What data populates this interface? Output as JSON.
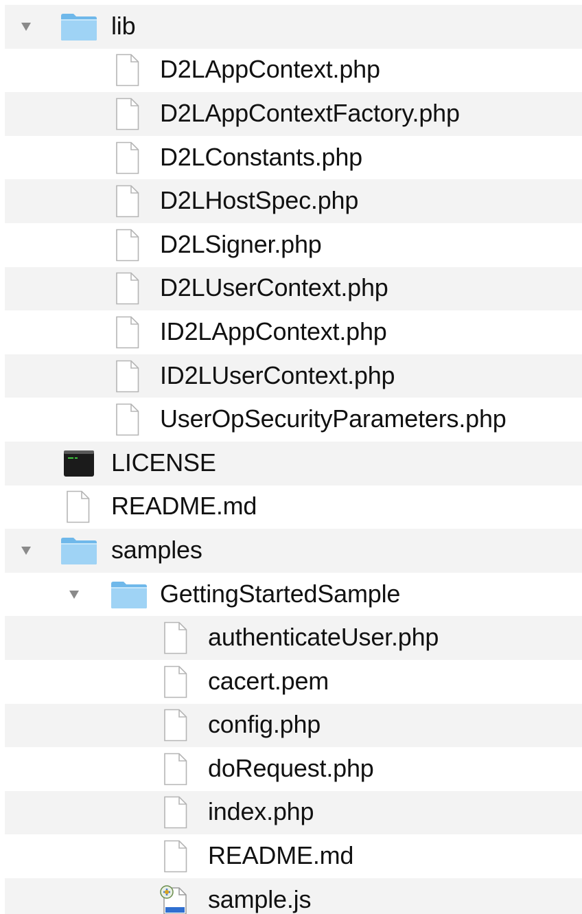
{
  "file_tree": {
    "rows": [
      {
        "label": "lib",
        "type": "folder",
        "level": 0,
        "expanded": true
      },
      {
        "label": "D2LAppContext.php",
        "type": "file",
        "level": 1
      },
      {
        "label": "D2LAppContextFactory.php",
        "type": "file",
        "level": 1
      },
      {
        "label": "D2LConstants.php",
        "type": "file",
        "level": 1
      },
      {
        "label": "D2LHostSpec.php",
        "type": "file",
        "level": 1
      },
      {
        "label": "D2LSigner.php",
        "type": "file",
        "level": 1
      },
      {
        "label": "D2LUserContext.php",
        "type": "file",
        "level": 1
      },
      {
        "label": "ID2LAppContext.php",
        "type": "file",
        "level": 1
      },
      {
        "label": "ID2LUserContext.php",
        "type": "file",
        "level": 1
      },
      {
        "label": "UserOpSecurityParameters.php",
        "type": "file",
        "level": 1
      },
      {
        "label": "LICENSE",
        "type": "executable",
        "level": 0
      },
      {
        "label": "README.md",
        "type": "file",
        "level": 0
      },
      {
        "label": "samples",
        "type": "folder",
        "level": 0,
        "expanded": true
      },
      {
        "label": "GettingStartedSample",
        "type": "folder",
        "level": 1,
        "expanded": true
      },
      {
        "label": "authenticateUser.php",
        "type": "file",
        "level": 2
      },
      {
        "label": "cacert.pem",
        "type": "file",
        "level": 2
      },
      {
        "label": "config.php",
        "type": "file",
        "level": 2
      },
      {
        "label": "doRequest.php",
        "type": "file",
        "level": 2
      },
      {
        "label": "index.php",
        "type": "file",
        "level": 2
      },
      {
        "label": "README.md",
        "type": "file",
        "level": 2
      },
      {
        "label": "sample.js",
        "type": "script",
        "level": 2
      }
    ]
  },
  "icons": {
    "folder": "folder-icon",
    "file": "document-icon",
    "executable": "terminal-executable-icon",
    "script": "javascript-script-icon",
    "disclosure": "disclosure-triangle-down-icon"
  },
  "colors": {
    "row_alternate": "#f3f3f3",
    "row_base": "#ffffff",
    "folder_fill": "#9fd3f5",
    "folder_tab": "#6fb8ea",
    "text": "#111111",
    "disclosure": "#8a8a8a"
  }
}
